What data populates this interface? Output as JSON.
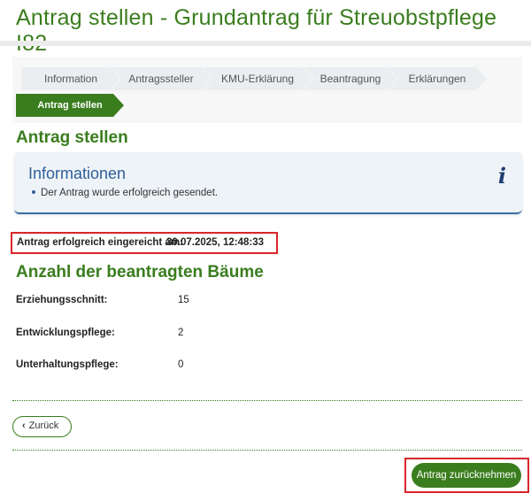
{
  "page": {
    "title": "Antrag stellen - Grundantrag für Streuobstpflege I82"
  },
  "wizard": {
    "steps": [
      {
        "label": "Information"
      },
      {
        "label": "Antragssteller"
      },
      {
        "label": "KMU-Erklärung"
      },
      {
        "label": "Beantragung"
      },
      {
        "label": "Erklärungen"
      },
      {
        "label": "Antrag stellen",
        "active": true
      }
    ]
  },
  "section": {
    "title": "Antrag stellen"
  },
  "info": {
    "title": "Informationen",
    "message": "Der Antrag wurde erfolgreich gesendet.",
    "icon": "info-icon"
  },
  "submission": {
    "label": "Antrag erfolgreich eingereicht am:",
    "value": "30.07.2025, 12:48:33"
  },
  "trees": {
    "title": "Anzahl der beantragten Bäume",
    "rows": [
      {
        "label": "Erziehungsschnitt:",
        "value": "15"
      },
      {
        "label": "Entwicklungspflege:",
        "value": "2"
      },
      {
        "label": "Unterhaltungspflege:",
        "value": "0"
      }
    ]
  },
  "actions": {
    "back_icon": "chevron-left-icon",
    "back_label": "Zurück",
    "withdraw_label": "Antrag zurücknehmen"
  },
  "colors": {
    "brand_green": "#3a7d1e",
    "info_blue": "#2f5f97",
    "highlight_red": "#d9262a"
  }
}
